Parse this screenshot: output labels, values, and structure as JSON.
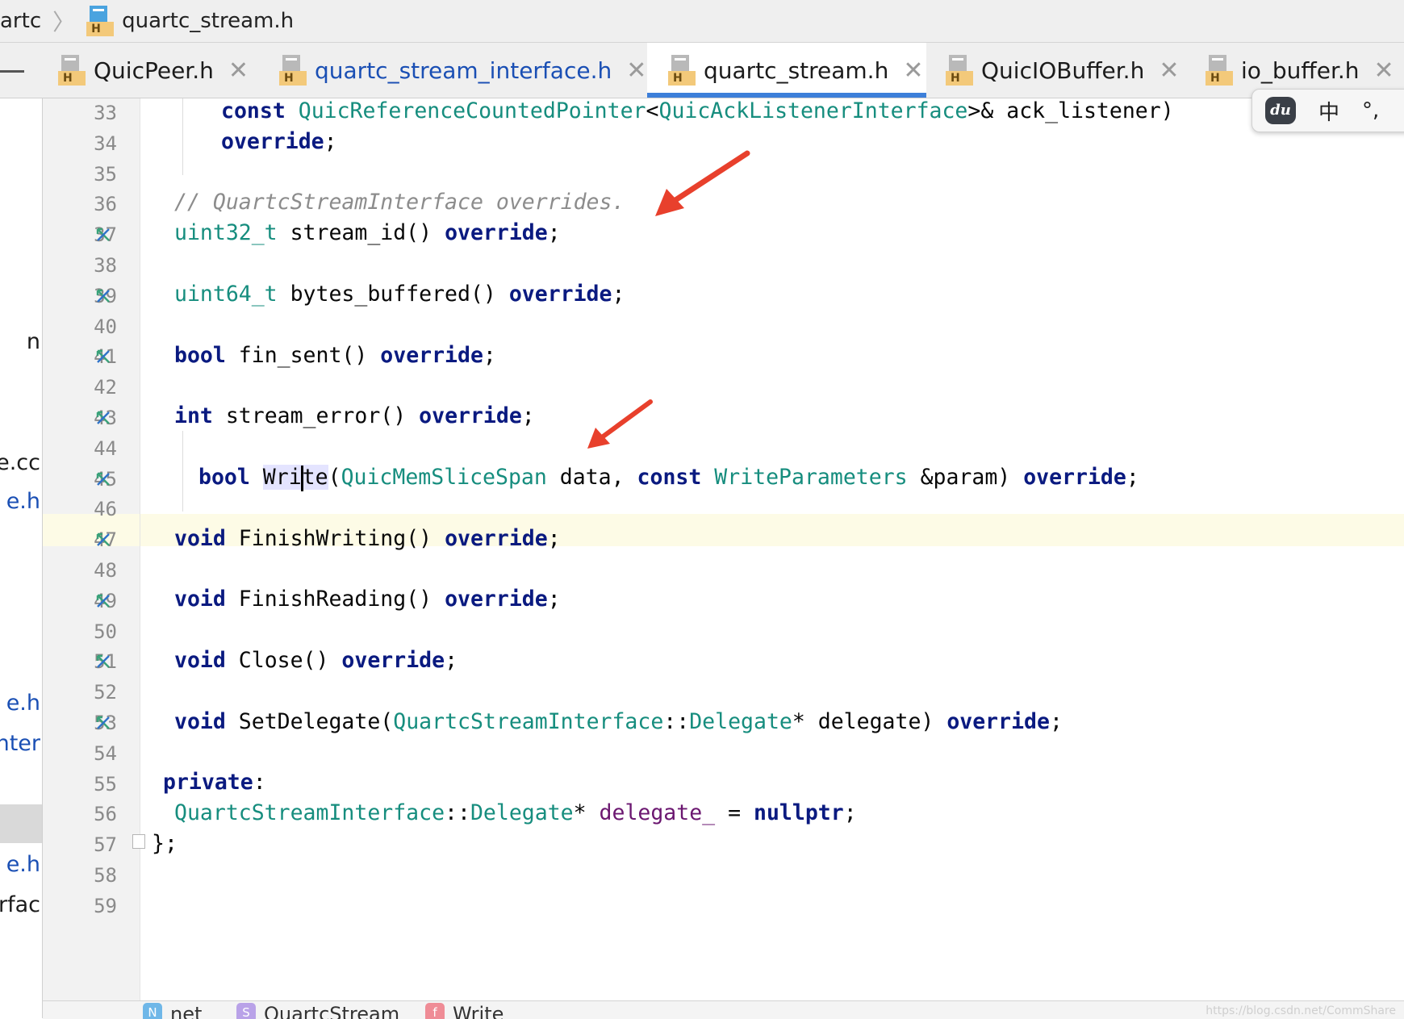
{
  "breadcrumb": {
    "parent": "artc",
    "file": "quartc_stream.h"
  },
  "tabs": [
    {
      "label": "QuicPeer.h",
      "close": "✕"
    },
    {
      "label": "quartc_stream_interface.h",
      "close": "✕"
    },
    {
      "label": "quartc_stream.h",
      "close": "✕"
    },
    {
      "label": "QuicIOBuffer.h",
      "close": "✕"
    },
    {
      "label": "io_buffer.h",
      "close": "✕"
    }
  ],
  "file_icon_badge": "H",
  "ime": {
    "logo": "du",
    "mode": "中",
    "punct": "°,"
  },
  "project_items": [
    "n",
    "e.cc",
    "e.h",
    "e.h",
    "nter",
    "e.h",
    "erfac"
  ],
  "line_numbers": [
    "33",
    "34",
    "35",
    "36",
    "37",
    "38",
    "39",
    "40",
    "41",
    "42",
    "43",
    "44",
    "45",
    "46",
    "47",
    "48",
    "49",
    "50",
    "51",
    "52",
    "53",
    "54",
    "55",
    "56",
    "57",
    "58",
    "59"
  ],
  "code": {
    "l33_kw": "const ",
    "l33_t1": "QuicReferenceCountedPointer",
    "l33_p1": "<",
    "l33_t2": "QuicAckListenerInterface",
    "l33_p2": ">& ack_listener)",
    "l34_kw": "override",
    "l34_p": ";",
    "l36_cm": "// QuartcStreamInterface overrides.",
    "l37_t": "uint32_t",
    "l37_p": " stream_id() ",
    "l37_kw": "override",
    "l37_e": ";",
    "l39_t": "uint64_t",
    "l39_p": " bytes_buffered() ",
    "l39_kw": "override",
    "l39_e": ";",
    "l41_kw1": "bool",
    "l41_p": " fin_sent() ",
    "l41_kw2": "override",
    "l41_e": ";",
    "l43_kw1": "int",
    "l43_p": " stream_error() ",
    "l43_kw2": "override",
    "l43_e": ";",
    "l45_kw1": "bool",
    "l45_sp": " ",
    "l45_w1": "Wri",
    "l45_w2": "te",
    "l45_p1": "(",
    "l45_t1": "QuicMemSliceSpan",
    "l45_p2": " data, ",
    "l45_kw2": "const",
    "l45_sp2": " ",
    "l45_t2": "WriteParameters",
    "l45_p3": " &param) ",
    "l45_kw3": "override",
    "l45_e": ";",
    "l47_kw1": "void",
    "l47_p": " FinishWriting() ",
    "l47_kw2": "override",
    "l47_e": ";",
    "l49_kw1": "void",
    "l49_p": " FinishReading() ",
    "l49_kw2": "override",
    "l49_e": ";",
    "l51_kw1": "void",
    "l51_p": " Close() ",
    "l51_kw2": "override",
    "l51_e": ";",
    "l53_kw1": "void",
    "l53_p1": " SetDelegate(",
    "l53_t1": "QuartcStreamInterface",
    "l53_p2": "::",
    "l53_t2": "Delegate",
    "l53_p3": "* delegate) ",
    "l53_kw2": "override",
    "l53_e": ";",
    "l55_kw": "private",
    "l55_p": ":",
    "l56_t1": "QuartcStreamInterface",
    "l56_p1": "::",
    "l56_t2": "Delegate",
    "l56_p2": "* ",
    "l56_f": "delegate_",
    "l56_p3": " = ",
    "l56_kw": "nullptr",
    "l56_e": ";",
    "l57": "};"
  },
  "status_breadcrumb": [
    {
      "chip": "N",
      "label": "net",
      "color": "#6fb7e8"
    },
    {
      "chip": "S",
      "label": "QuartcStream",
      "color": "#b9a2e8"
    },
    {
      "chip": "f",
      "label": "Write",
      "color": "#ef8c96"
    }
  ],
  "watermark": "https://blog.csdn.net/CommShare",
  "colors": {
    "keyword": "#0a1a80",
    "type": "#168d7e",
    "comment": "#8c8c8c",
    "tab_active_underline": "#3d7fd9",
    "current_line": "#fdfbe6",
    "arrow": "#e8402c"
  }
}
